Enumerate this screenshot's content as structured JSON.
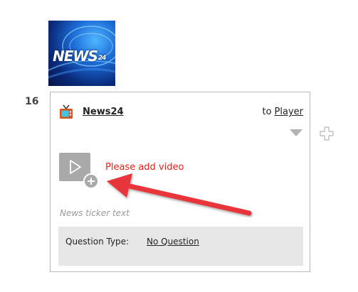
{
  "row": {
    "number": "16",
    "channel_name": "News24",
    "to_label": "to",
    "to_target": "Player",
    "video_prompt": "Please add video",
    "ticker_placeholder": "News ticker text",
    "question_type_label": "Question Type:",
    "question_type_value": "No Question"
  },
  "thumbnail": {
    "brand_text": "NEWS",
    "brand_num": "24"
  },
  "icons": {
    "channel": "tv-icon",
    "video": "add-video-icon",
    "dropdown": "chevron-down-icon",
    "add_row": "plus-icon",
    "annotation": "red-arrow-annotation"
  },
  "colors": {
    "error_text": "#e8201c",
    "arrow": "#e8353a",
    "panel_bg": "#e7e7e7"
  }
}
